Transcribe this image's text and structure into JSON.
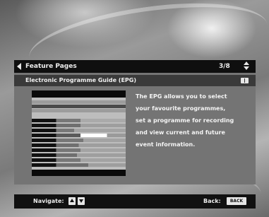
{
  "header": {
    "title": "Feature Pages",
    "page_indicator": "3/8"
  },
  "section": {
    "title": "Electronic Programme Guide (EPG)"
  },
  "description": {
    "lines": [
      "The EPG allows you to select",
      "your favourite programmes,",
      "set a programme for recording",
      "and view current and future",
      "event information."
    ]
  },
  "footer": {
    "navigate_label": "Navigate:",
    "back_label": "Back:",
    "back_key_label": "BACK"
  },
  "colors": {
    "bar_dark": "#0f0f0f",
    "panel": "#747474",
    "text": "#ededed",
    "key_bg": "#e6e6e6"
  },
  "icons": {
    "left": "left-arrow-icon",
    "updown": "up-down-arrows-icon",
    "info": "book-icon",
    "up_key": "up-arrow-icon",
    "down_key": "down-arrow-icon"
  }
}
